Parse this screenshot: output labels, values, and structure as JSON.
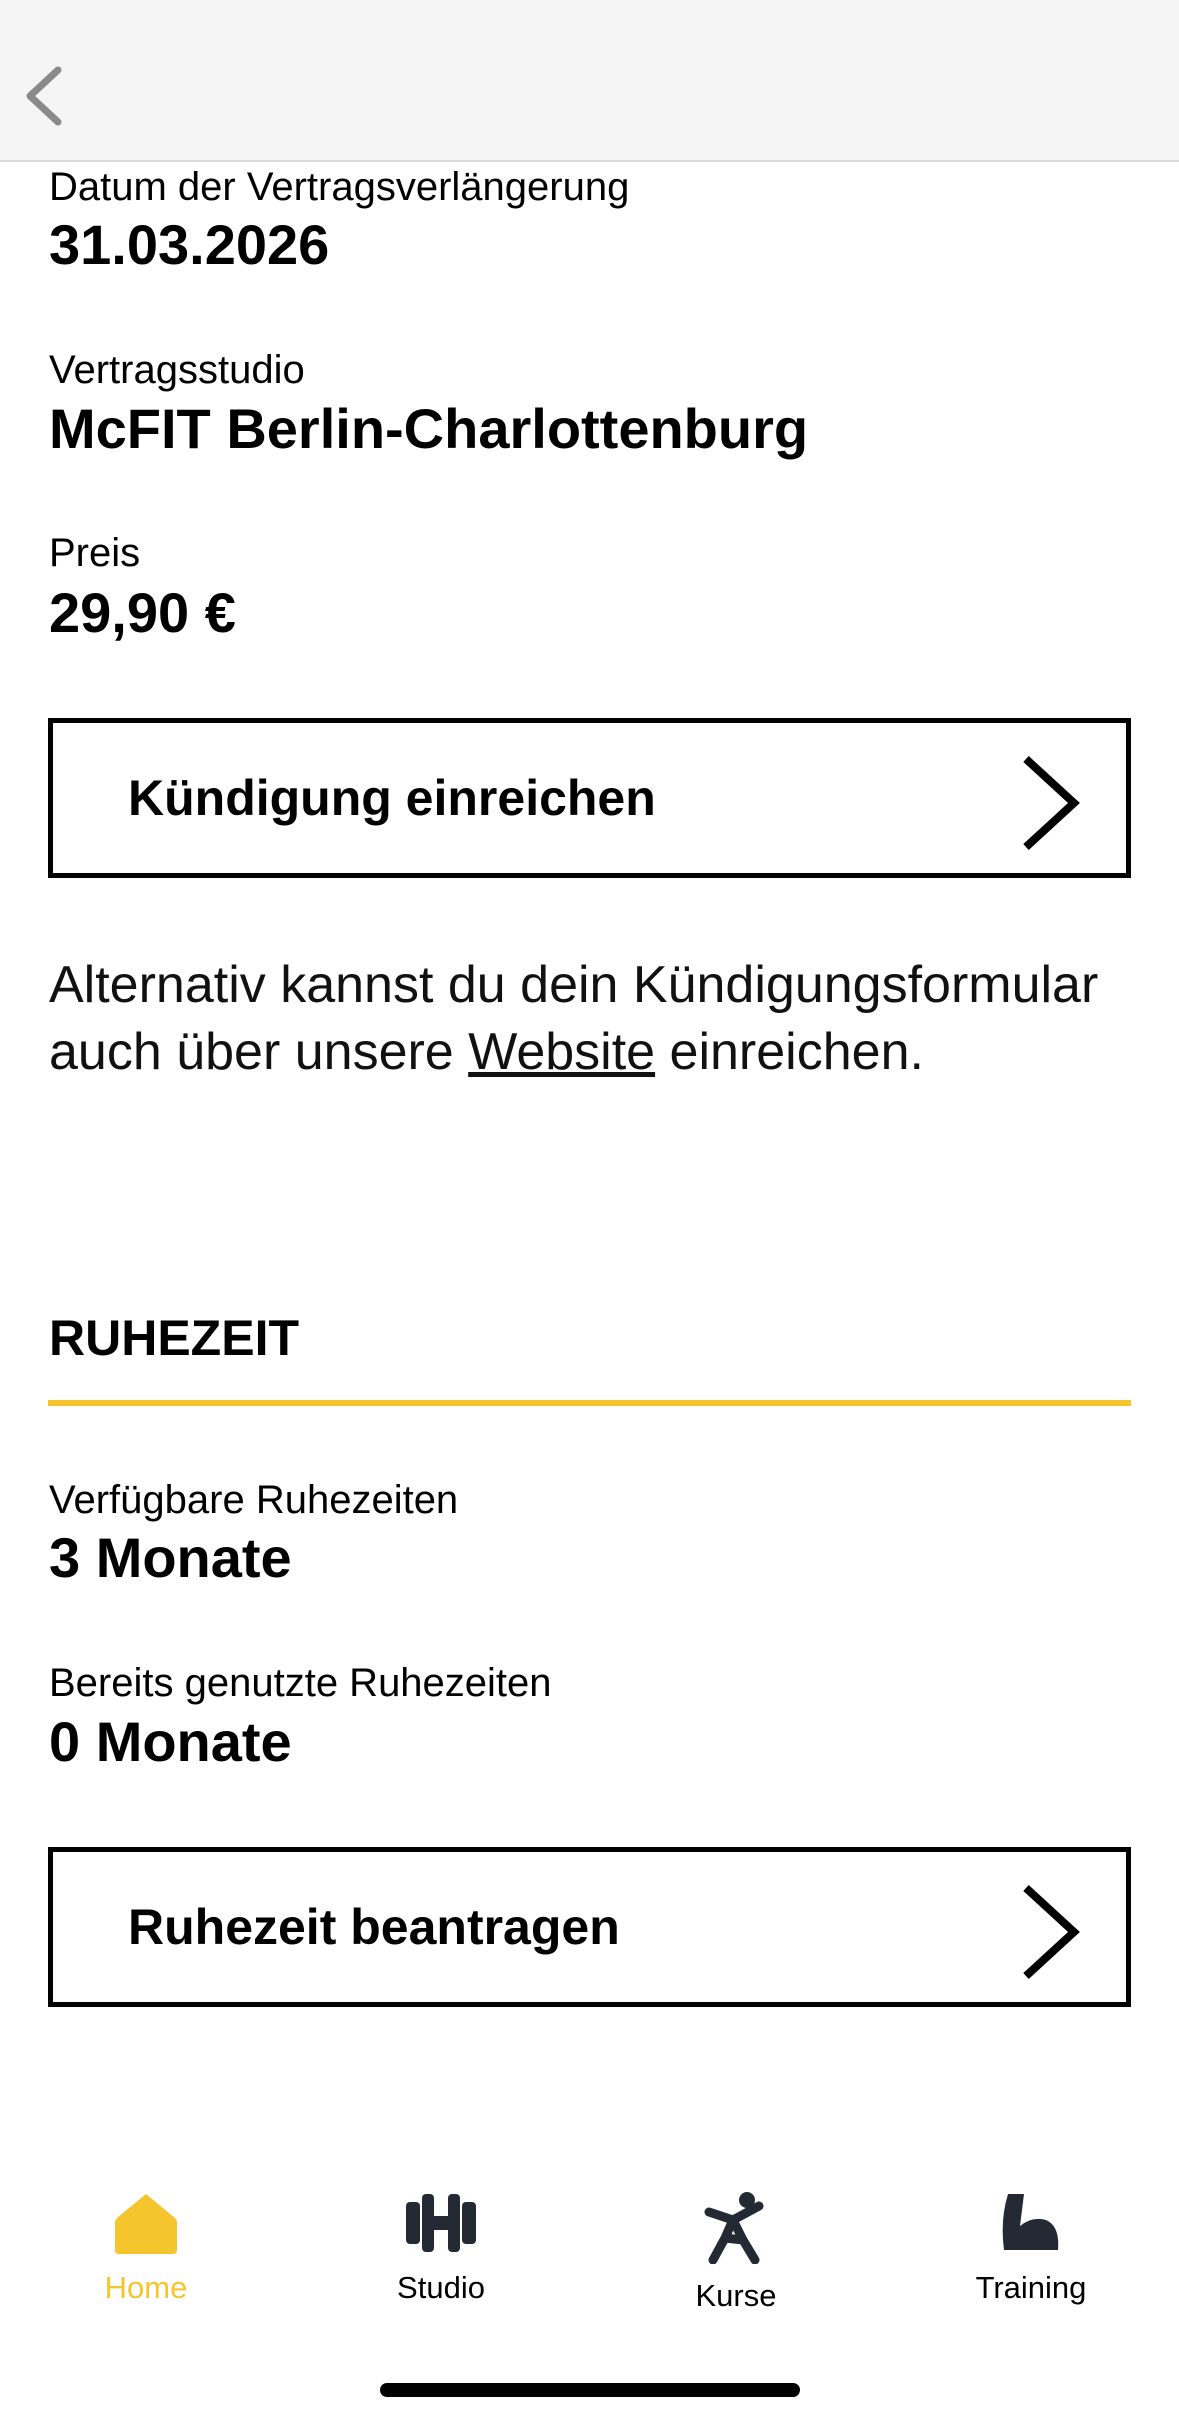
{
  "header": {
    "back_icon": "chevron-left-icon"
  },
  "contract": {
    "renewal_date_label": "Datum der Vertragsverlängerung",
    "renewal_date": "31.03.2026",
    "studio_label": "Vertragsstudio",
    "studio": "McFIT Berlin-Charlottenburg",
    "price_label": "Preis",
    "price": "29,90 €"
  },
  "cancel_button": {
    "label": "Kündigung einreichen",
    "icon": "chevron-right-icon"
  },
  "alternative": {
    "text_before": "Alternativ kannst du dein Kündigungsformular auch über unsere ",
    "link": "Website",
    "text_after": " einreichen."
  },
  "rest_period": {
    "title": "RUHEZEIT",
    "available_label": "Verfügbare Ruhezeiten",
    "available_value": "3 Monate",
    "used_label": "Bereits genutzte Ruhezeiten",
    "used_value": "0 Monate",
    "button_label": "Ruhezeit beantragen"
  },
  "tabbar": {
    "active_color": "#f5c52e",
    "items": [
      {
        "label": "Home",
        "icon": "home-icon",
        "active": true
      },
      {
        "label": "Studio",
        "icon": "dumbbell-icon",
        "active": false
      },
      {
        "label": "Kurse",
        "icon": "person-exercise-icon",
        "active": false
      },
      {
        "label": "Training",
        "icon": "flexed-arm-icon",
        "active": false
      }
    ]
  }
}
